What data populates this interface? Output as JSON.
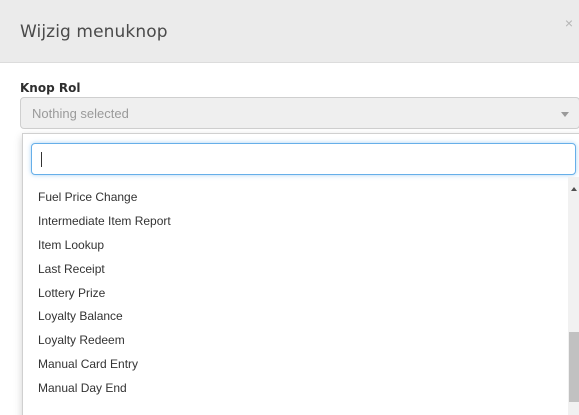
{
  "modal": {
    "title": "Wijzig menuknop",
    "close_symbol": "×"
  },
  "field": {
    "label": "Knop Rol",
    "selected_text": "Nothing selected"
  },
  "dropdown": {
    "search_value": "",
    "options": [
      "Fuel Price Change",
      "Intermediate Item Report",
      "Item Lookup",
      "Last Receipt",
      "Lottery Prize",
      "Loyalty Balance",
      "Loyalty Redeem",
      "Manual Card Entry",
      "Manual Day End"
    ]
  },
  "icons": {
    "close": "close-icon",
    "caret": "caret-down-icon",
    "scroll_up": "scroll-up-arrow-icon"
  },
  "colors": {
    "header_bg": "#ebebeb",
    "focus_border": "#66afe9",
    "select_bg": "#efefef"
  }
}
